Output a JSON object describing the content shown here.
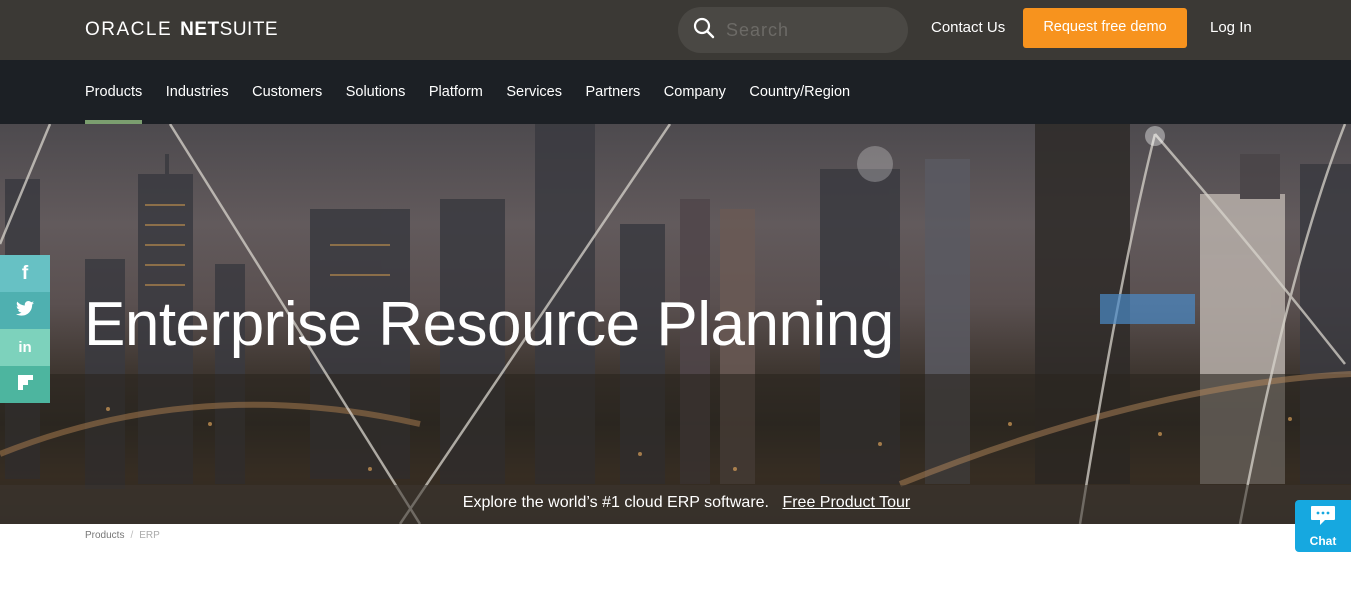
{
  "header": {
    "logo": {
      "part1": "ORACLE",
      "part2_bold": "NET",
      "part2_regular": "SUITE"
    },
    "search": {
      "placeholder": "Search",
      "value": ""
    },
    "contact_label": "Contact Us",
    "demo_label": "Request free demo",
    "login_label": "Log In",
    "accent_color": "#f7931e"
  },
  "nav": {
    "items": [
      {
        "label": "Products",
        "active": true
      },
      {
        "label": "Industries",
        "active": false
      },
      {
        "label": "Customers",
        "active": false
      },
      {
        "label": "Solutions",
        "active": false
      },
      {
        "label": "Platform",
        "active": false
      },
      {
        "label": "Services",
        "active": false
      },
      {
        "label": "Partners",
        "active": false
      },
      {
        "label": "Company",
        "active": false
      },
      {
        "label": "Country/Region",
        "active": false
      }
    ],
    "active_color": "#7b9e6f"
  },
  "hero": {
    "title": "Enterprise Resource Planning",
    "cta_text": "Explore the world’s #1 cloud ERP software.",
    "cta_link": "Free Product Tour"
  },
  "social": [
    {
      "icon": "facebook-icon",
      "glyph": "f"
    },
    {
      "icon": "twitter-icon",
      "glyph": "🐦"
    },
    {
      "icon": "linkedin-icon",
      "glyph": "in"
    },
    {
      "icon": "flipboard-icon",
      "glyph": "F"
    }
  ],
  "breadcrumb": {
    "items": [
      "Products",
      "ERP"
    ],
    "separator": "/"
  },
  "chat": {
    "label": "Chat",
    "icon": "chat-bubble-icon"
  }
}
